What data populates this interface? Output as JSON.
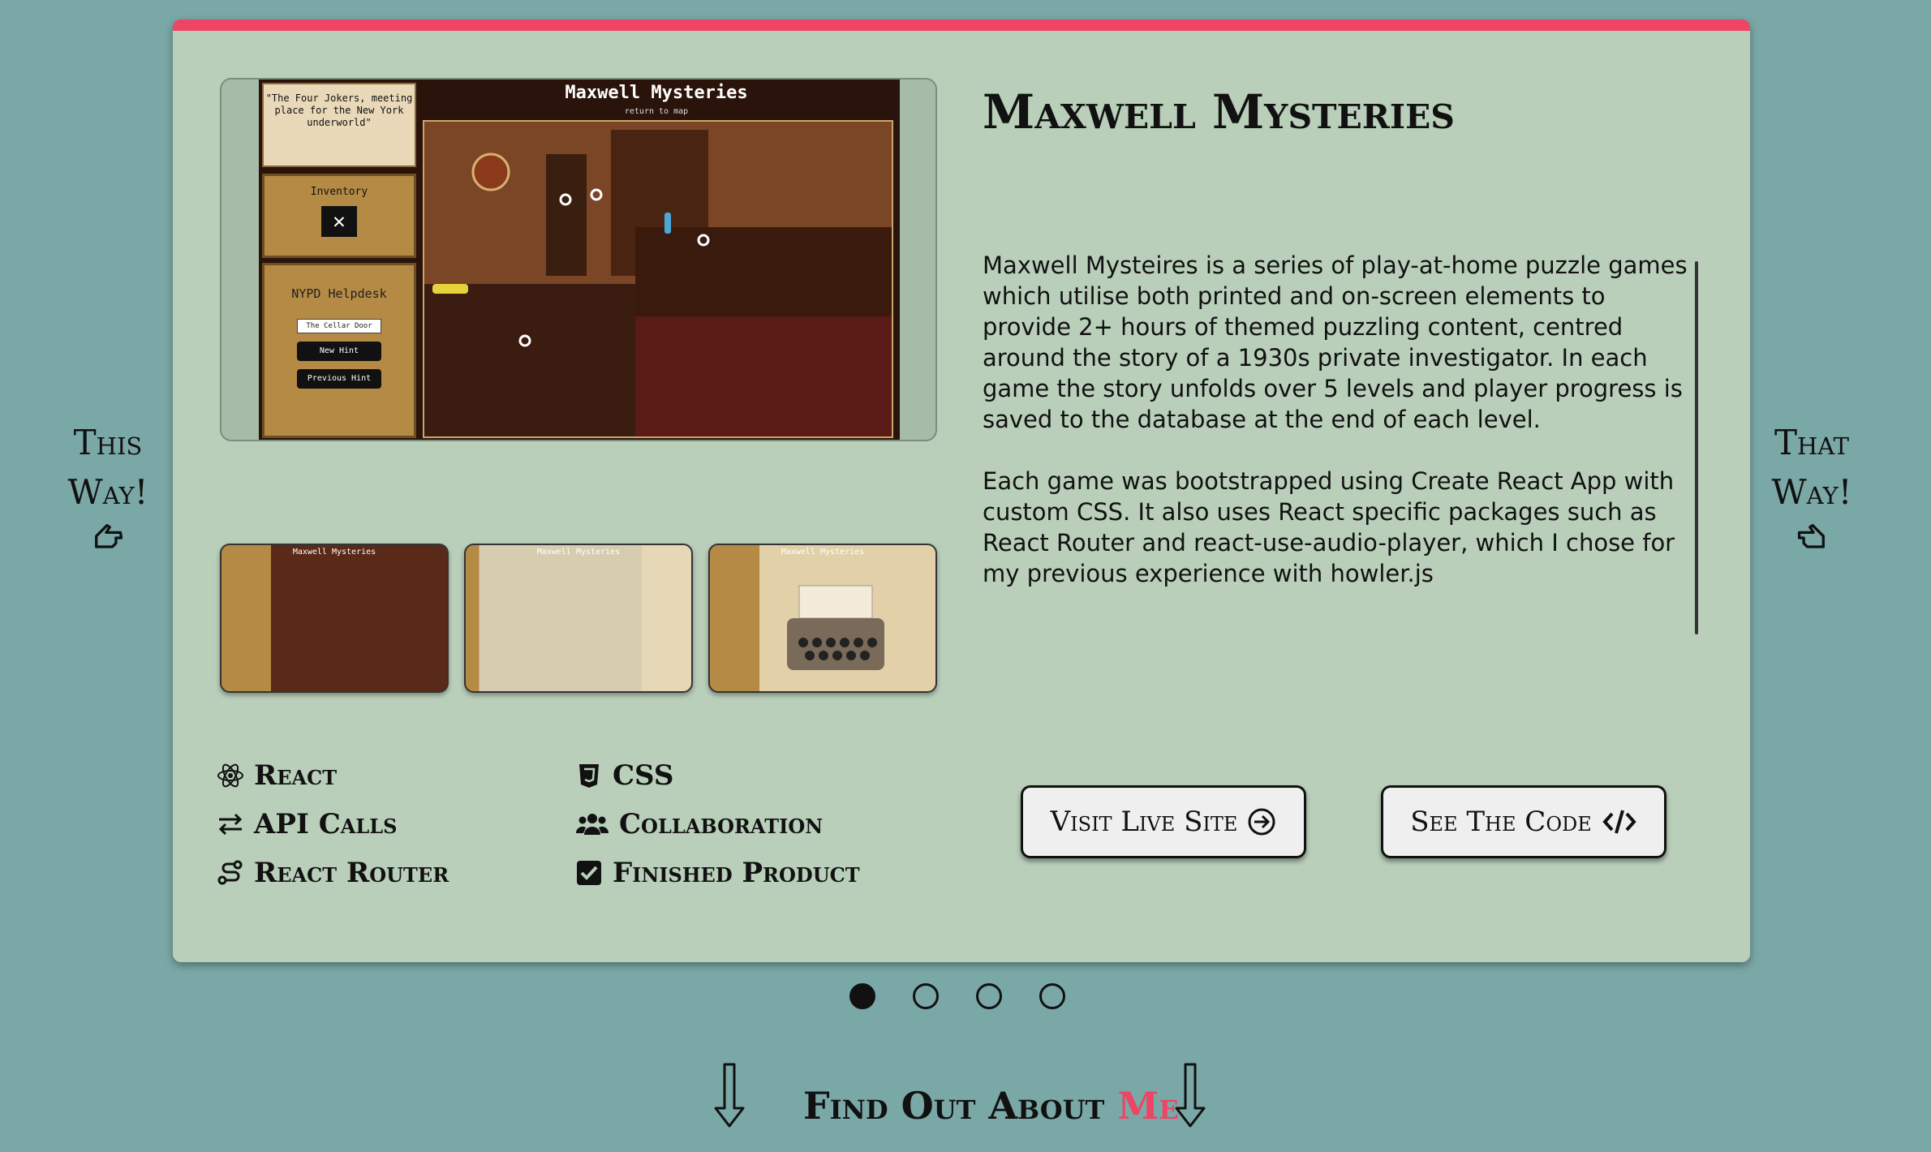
{
  "navigation": {
    "prev_line1": "This",
    "prev_line2": "Way!",
    "next_line1": "That",
    "next_line2": "Way!"
  },
  "project": {
    "title": "Maxwell Mysteries",
    "description": [
      "Maxwell Mysteires is a series of play-at-home puzzle games which utilise both printed and on-screen elements to provide 2+ hours of themed puzzling content, centred around the story of a 1930s private investigator. In each game the story unfolds over 5 levels and player progress is saved to the database at the end of each level.",
      "Each game was bootstrapped using Create React App with custom CSS. It also uses React specific packages such as React Router and react-use-audio-player, which I chose for my previous experience with howler.js"
    ]
  },
  "screenshot": {
    "game_title": "Maxwell Mysteries",
    "game_subtitle": "return to map",
    "quote": "\"The Four Jokers, meeting place for the New York underworld\"",
    "inventory_label": "Inventory",
    "helpdesk_label": "NYPD Helpdesk",
    "helpdesk_select": "The Cellar Door",
    "new_hint": "New Hint",
    "previous_hint": "Previous Hint"
  },
  "thumbnails": [
    {
      "caption": "Maxwell Mysteries"
    },
    {
      "caption": "Maxwell Mysteries"
    },
    {
      "caption": "Maxwell Mysteries"
    }
  ],
  "tech": [
    {
      "label": "React",
      "icon": "react-icon"
    },
    {
      "label": "CSS",
      "icon": "css3-icon"
    },
    {
      "label": "API Calls",
      "icon": "exchange-arrows-icon"
    },
    {
      "label": "Collaboration",
      "icon": "users-icon"
    },
    {
      "label": "React Router",
      "icon": "route-icon"
    },
    {
      "label": "Finished Product",
      "icon": "check-square-icon"
    }
  ],
  "buttons": {
    "live": "Visit Live Site",
    "code": "See The Code"
  },
  "carousel": {
    "active_index": 0,
    "count": 4
  },
  "footer": {
    "find_out_prefix": "Find Out About ",
    "find_out_accent": "Me"
  },
  "colors": {
    "background": "#7aa8a6",
    "card": "#b9cfba",
    "accent": "#ee4466"
  }
}
